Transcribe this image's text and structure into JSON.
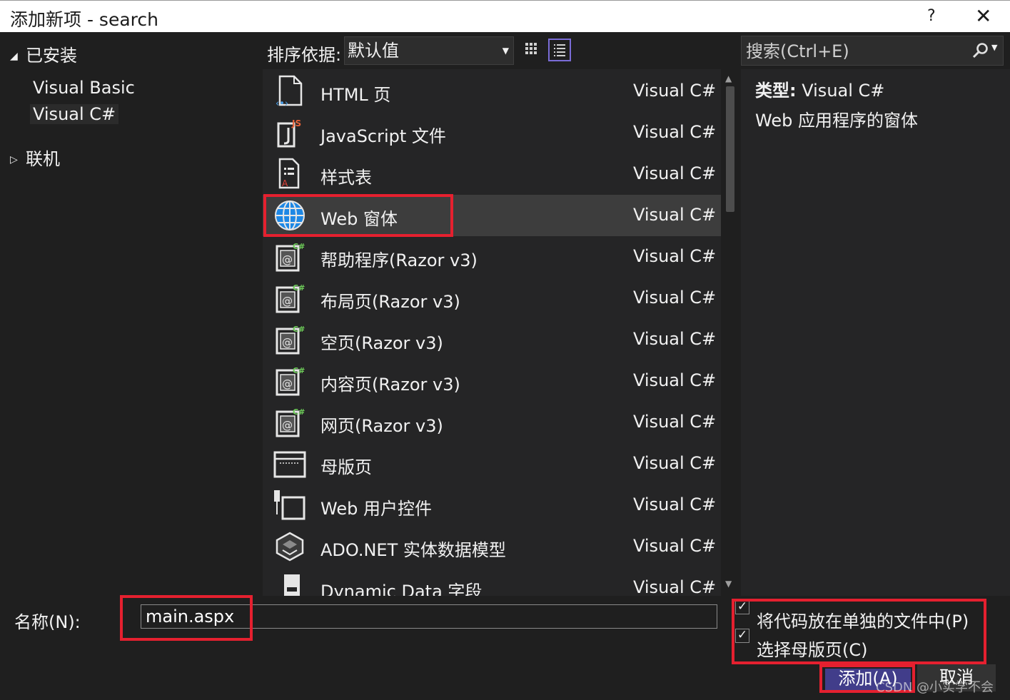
{
  "window": {
    "title": "添加新项 - search",
    "help": "?",
    "close": "✕"
  },
  "tree": {
    "installed": "已安装",
    "children": [
      "Visual Basic",
      "Visual C#"
    ],
    "online": "联机"
  },
  "sort": {
    "label": "排序依据:",
    "value": "默认值"
  },
  "search": {
    "placeholder": "搜索(Ctrl+E)"
  },
  "items": [
    {
      "name": "HTML 页",
      "lang": "Visual C#",
      "icon": "html-page-icon"
    },
    {
      "name": "JavaScript 文件",
      "lang": "Visual C#",
      "icon": "javascript-file-icon"
    },
    {
      "name": "样式表",
      "lang": "Visual C#",
      "icon": "stylesheet-icon"
    },
    {
      "name": "Web 窗体",
      "lang": "Visual C#",
      "icon": "globe-icon",
      "selected": true
    },
    {
      "name": "帮助程序(Razor v3)",
      "lang": "Visual C#",
      "icon": "razor-page-icon"
    },
    {
      "name": "布局页(Razor v3)",
      "lang": "Visual C#",
      "icon": "razor-page-icon"
    },
    {
      "name": "空页(Razor v3)",
      "lang": "Visual C#",
      "icon": "razor-page-icon"
    },
    {
      "name": "内容页(Razor v3)",
      "lang": "Visual C#",
      "icon": "razor-page-icon"
    },
    {
      "name": "网页(Razor v3)",
      "lang": "Visual C#",
      "icon": "razor-page-icon"
    },
    {
      "name": "母版页",
      "lang": "Visual C#",
      "icon": "master-page-icon"
    },
    {
      "name": "Web 用户控件",
      "lang": "Visual C#",
      "icon": "user-control-icon"
    },
    {
      "name": "ADO.NET 实体数据模型",
      "lang": "Visual C#",
      "icon": "entity-model-icon"
    },
    {
      "name": "Dynamic Data 字段",
      "lang": "Visual C#",
      "icon": "dynamic-data-icon"
    }
  ],
  "details": {
    "type_label": "类型:",
    "type_value": "Visual C#",
    "description": "Web 应用程序的窗体"
  },
  "name_field": {
    "label": "名称(N):",
    "value": "main.aspx"
  },
  "options": {
    "separate_code": "将代码放在单独的文件中(P)",
    "select_master": "选择母版页(C)"
  },
  "buttons": {
    "add": "添加(A)",
    "cancel": "取消"
  },
  "watermark": "CSDN @小实学不会",
  "colors": {
    "highlight": "#e5202f",
    "accent": "#7a6cd6",
    "add_button": "#413d8a"
  }
}
